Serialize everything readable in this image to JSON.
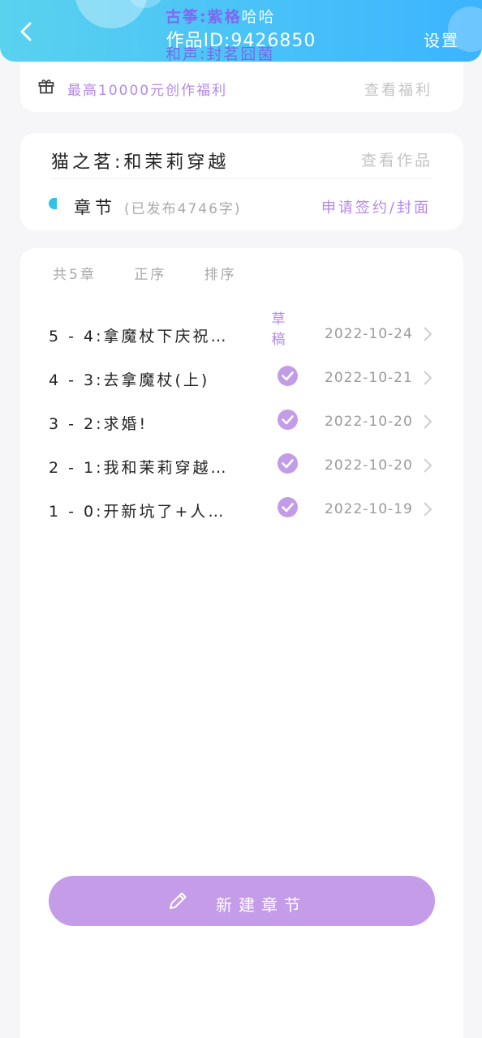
{
  "header": {
    "title": "作品ID:9426850",
    "watermark_line1_bold": "古筝:紫格",
    "watermark_line1_plain": "哈哈",
    "watermark_line2": "和声:封茗囧菌",
    "settings_label": "设置",
    "colors": {
      "gradient_start": "#59d2ef",
      "gradient_end": "#3cb4ff"
    }
  },
  "welfare": {
    "text": "最高10000元创作福利",
    "link": "查看福利",
    "icon": "gift-icon"
  },
  "work": {
    "title": "猫之茗:和茉莉穿越",
    "view_link": "查看作品",
    "chapter_label": "章节",
    "published_info": "(已发布4746字)",
    "apply_link": "申请签约/封面"
  },
  "list": {
    "count_label": "共5章",
    "order_label": "正序",
    "sort_label": "排序",
    "chapters": [
      {
        "title": "5 - 4:拿魔杖下庆祝…",
        "status": "草稿",
        "date": "2022-10-24"
      },
      {
        "title": "4 - 3:去拿魔杖(上)",
        "status": "check-icon",
        "date": "2022-10-21"
      },
      {
        "title": "3 - 2:求婚!",
        "status": "check-icon",
        "date": "2022-10-20"
      },
      {
        "title": "2 - 1:我和茉莉穿越…",
        "status": "check-icon",
        "date": "2022-10-20"
      },
      {
        "title": "1 - 0:开新坑了+人…",
        "status": "check-icon",
        "date": "2022-10-19"
      }
    ]
  },
  "new_chapter": {
    "label": "新建章节",
    "icon": "pencil-icon"
  },
  "colors": {
    "accent_purple": "#b48ae8",
    "button_purple": "#c49ce8",
    "cyan_dot": "#2fc1e6"
  }
}
